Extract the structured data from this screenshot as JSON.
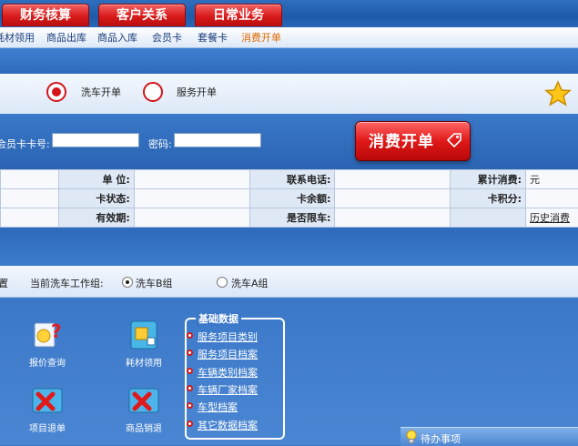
{
  "main_tabs": [
    {
      "label": "财务核算"
    },
    {
      "label": "客户关系"
    },
    {
      "label": "日常业务"
    }
  ],
  "sub_nav": [
    {
      "label": "耗材领用",
      "active": false
    },
    {
      "label": "商品出库",
      "active": false
    },
    {
      "label": "商品入库",
      "active": false
    },
    {
      "label": "会员卡",
      "active": false
    },
    {
      "label": "套餐卡",
      "active": false
    },
    {
      "label": "消费开单",
      "active": true
    }
  ],
  "order_type": {
    "options": [
      {
        "label": "洗车开单",
        "selected": true
      },
      {
        "label": "服务开单",
        "selected": false
      }
    ]
  },
  "card": {
    "card_no_label": "会员卡卡号:",
    "card_no_value": "",
    "password_label": "密码:",
    "password_value": "",
    "consume_button": "消费开单"
  },
  "info_table": {
    "rows": [
      [
        {
          "label": "单  位:",
          "value": ""
        },
        {
          "label": "联系电话:",
          "value": ""
        },
        {
          "label": "累计消费:",
          "value": "元"
        }
      ],
      [
        {
          "label": "卡状态:",
          "value": ""
        },
        {
          "label": "卡余额:",
          "value": ""
        },
        {
          "label": "卡积分:",
          "value": ""
        }
      ],
      [
        {
          "label": "有效期:",
          "value": ""
        },
        {
          "label": "是否限车:",
          "value": ""
        },
        {
          "label": "",
          "value": "历史消费"
        }
      ]
    ]
  },
  "wash_group": {
    "left_fragment": "置",
    "label": "当前洗车工作组:",
    "options": [
      {
        "label": "洗车B组",
        "selected": true
      },
      {
        "label": "洗车A组",
        "selected": false
      }
    ]
  },
  "quick_actions": [
    {
      "label": "报价查询",
      "icon": "price-query-icon"
    },
    {
      "label": "耗材领用",
      "icon": "material-icon"
    },
    {
      "label": "项目退单",
      "icon": "cancel-order-icon"
    },
    {
      "label": "商品销退",
      "icon": "goods-return-icon"
    }
  ],
  "base_data": {
    "title": "基础数据",
    "items": [
      {
        "label": "服务项目类别"
      },
      {
        "label": "服务项目档案"
      },
      {
        "label": "车辆类别档案"
      },
      {
        "label": "车辆厂家档案"
      },
      {
        "label": "车型档案"
      },
      {
        "label": "其它数据档案"
      }
    ]
  },
  "todo": {
    "label": "待办事项"
  },
  "colors": {
    "accent_red": "#d81a1a",
    "active_nav": "#e06a00",
    "base_blue": "#3f79c6"
  }
}
